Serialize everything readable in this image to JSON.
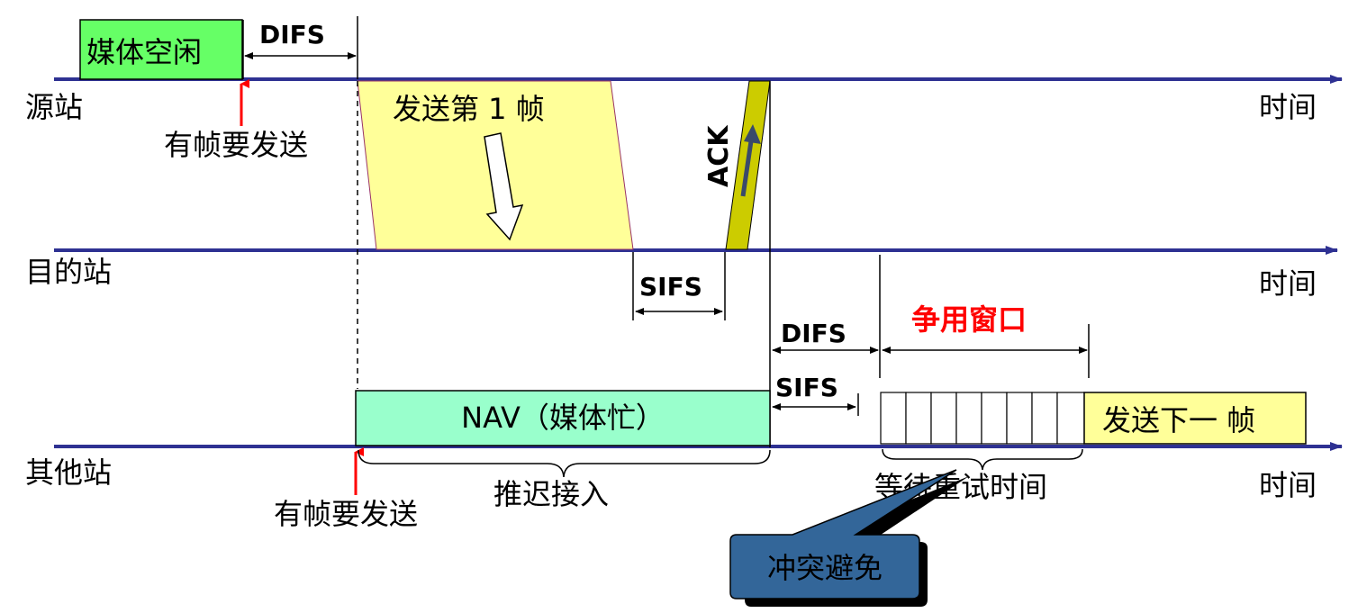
{
  "stations": {
    "source": "源站",
    "destination": "目的站",
    "other": "其他站"
  },
  "time_label": "时间",
  "labels": {
    "medium_idle": "媒体空闲",
    "difs_top": "DIFS",
    "has_frame_source": "有帧要发送",
    "send_first_frame": "发送第 1 帧",
    "ack": "ACK",
    "sifs_dest": "SIFS",
    "difs_mid": "DIFS",
    "contention_window": "争用窗口",
    "sifs_other": "SIFS",
    "nav": "NAV（媒体忙）",
    "send_next_frame": "发送下一 帧",
    "has_frame_other": "有帧要发送",
    "defer_access": "推迟接入",
    "wait_retry_time": "等待重试时间",
    "collision_avoidance": "冲突避免"
  },
  "colors": {
    "timeline": "#2e3192",
    "idle_box": "#66ff66",
    "frame_fill": "#ffff99",
    "ack_fill": "#cccc00",
    "nav_fill": "#99ffcc",
    "callout_fill": "#336699",
    "red": "#ff0000"
  }
}
